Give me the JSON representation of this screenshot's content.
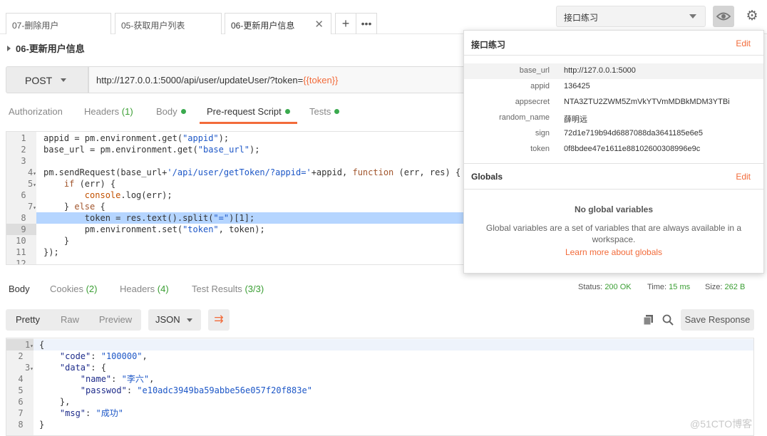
{
  "tabs": [
    {
      "label": "07-删除用户"
    },
    {
      "label": "05-获取用户列表"
    },
    {
      "label": "06-更新用户信息",
      "active": true
    }
  ],
  "tab_close_icon": "close-icon",
  "env_selector": {
    "value": "接口练习"
  },
  "icons": {
    "eye": "eye-icon",
    "gear": "gear-icon",
    "add": "plus-icon",
    "more": "more-icon"
  },
  "breadcrumb": {
    "title": "06-更新用户信息"
  },
  "request": {
    "method": "POST",
    "url_prefix": "http://127.0.0.1:5000/api/user/updateUser/?token=",
    "url_var": "{{token}}"
  },
  "request_tabs": [
    {
      "label": "Authorization"
    },
    {
      "label": "Headers",
      "count": "(1)"
    },
    {
      "label": "Body",
      "dot": true
    },
    {
      "label": "Pre-request Script",
      "dot": true,
      "active": true
    },
    {
      "label": "Tests",
      "dot": true
    }
  ],
  "script_lines": [
    {
      "n": "1",
      "text": "appid = pm.environment.get(\"appid\");"
    },
    {
      "n": "2",
      "text": "base_url = pm.environment.get(\"base_url\");"
    },
    {
      "n": "3",
      "text": ""
    },
    {
      "n": "4",
      "text": "pm.sendRequest(base_url+'/api/user/getToken/?appid='+appid, function (err, res) {"
    },
    {
      "n": "5",
      "text": "    if (err) {"
    },
    {
      "n": "6",
      "text": "        console.log(err);"
    },
    {
      "n": "7",
      "text": "    } else {"
    },
    {
      "n": "8",
      "text": "        token = res.text().split(\"=\")[1];"
    },
    {
      "n": "9",
      "text": "        pm.environment.set(\"token\", token);"
    },
    {
      "n": "10",
      "text": "    }"
    },
    {
      "n": "11",
      "text": "});"
    },
    {
      "n": "12",
      "text": ""
    }
  ],
  "response_tabs": [
    {
      "label": "Body",
      "active": true
    },
    {
      "label": "Cookies",
      "count": "(2)"
    },
    {
      "label": "Headers",
      "count": "(4)"
    },
    {
      "label": "Test Results",
      "count": "(3/3)"
    }
  ],
  "response_meta": {
    "status_label": "Status:",
    "status_value": "200 OK",
    "time_label": "Time:",
    "time_value": "15 ms",
    "size_label": "Size:",
    "size_value": "262 B"
  },
  "response_toolbar": {
    "pretty": "Pretty",
    "raw": "Raw",
    "preview": "Preview",
    "format": "JSON",
    "save": "Save Response",
    "wrap_icon": "wrap-icon",
    "copy_icon": "copy-icon",
    "search_icon": "search-icon"
  },
  "response_lines": [
    {
      "n": "1",
      "text": "{"
    },
    {
      "n": "2",
      "text": "    \"code\": \"100000\","
    },
    {
      "n": "3",
      "text": "    \"data\": {"
    },
    {
      "n": "4",
      "text": "        \"name\": \"李六\","
    },
    {
      "n": "5",
      "text": "        \"passwod\": \"e10adc3949ba59abbe56e057f20f883e\""
    },
    {
      "n": "6",
      "text": "    },"
    },
    {
      "n": "7",
      "text": "    \"msg\": \"成功\""
    },
    {
      "n": "8",
      "text": "}"
    }
  ],
  "env_popover": {
    "title": "接口练习",
    "edit": "Edit",
    "vars": [
      {
        "key": "base_url",
        "value": "http://127.0.0.1:5000"
      },
      {
        "key": "appid",
        "value": "136425"
      },
      {
        "key": "appsecret",
        "value": "NTA3ZTU2ZWM5ZmVkYTVmMDBkMDM3YTBi"
      },
      {
        "key": "random_name",
        "value": "薛明远"
      },
      {
        "key": "sign",
        "value": "72d1e719b94d6887088da3641185e6e5"
      },
      {
        "key": "token",
        "value": "0f8bdee47e1611e88102600308996e9c"
      }
    ],
    "globals_title": "Globals",
    "globals_edit": "Edit",
    "no_globals": "No global variables",
    "globals_desc_1": "Global variables are a set of variables that are always available in a",
    "globals_desc_2": "workspace.",
    "globals_link": "Learn more about globals"
  },
  "watermark": "@51CTO博客",
  "colors": {
    "accent": "#f26b3a",
    "ok": "#3a9e33"
  }
}
